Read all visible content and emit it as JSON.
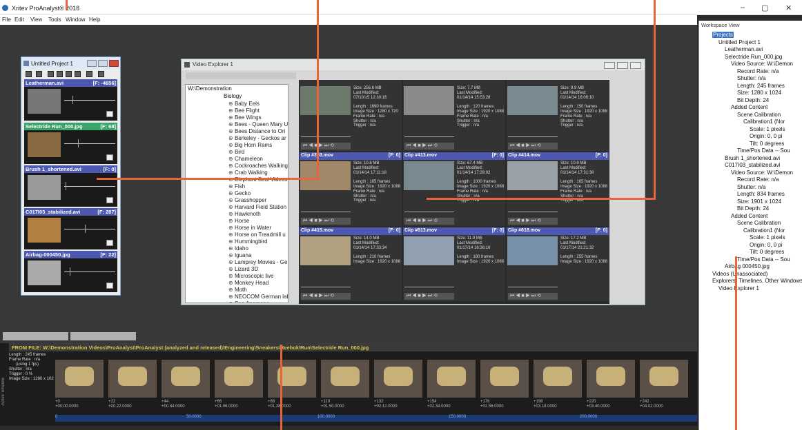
{
  "window": {
    "title": "Xritev ProAnalyst® 2018",
    "min": "–",
    "max": "▢",
    "close": "✕"
  },
  "menu": [
    "File",
    "Edit",
    "View",
    "Tools",
    "Window",
    "Help"
  ],
  "project": {
    "title": "Untitled Project 1",
    "clips": [
      {
        "name": "Leatherman.avi",
        "frame": "[F: -4656]",
        "selected": false
      },
      {
        "name": "Selectride Run_000.jpg",
        "frame": "[F: 68]",
        "selected": true
      },
      {
        "name": "Brush 1_shortened.avi",
        "frame": "[F: 0]",
        "selected": false
      },
      {
        "name": "C017I03_stabilized.avi",
        "frame": "[F: 287]",
        "selected": false
      },
      {
        "name": "Airbag-000450.jpg",
        "frame": "[F: 22]",
        "selected": false
      }
    ]
  },
  "explorer": {
    "title": "Video Explorer 1",
    "path": "W:\\Demonstration",
    "tree_root": "Biology",
    "tree": [
      "Baby Eels",
      "Bee Flight",
      "Bee Wings",
      "Bees - Queen Mary U",
      "Bees Distance to Ori",
      "Berkeley - Geckos ar",
      "Big Horn Rams",
      "Bird",
      "Chameleon",
      "Cockroaches Walking",
      "Crab Walking",
      "Elephant Seal Videos",
      "Fish",
      "Gecko",
      "Grasshopper",
      "Harvard Field Station",
      "Hawkmoth",
      "Horse",
      "Horse in Water",
      "Horse on Treadmill u",
      "Hummingbird",
      "Idaho",
      "Iguana",
      "Lamprey Movies - Ge",
      "Lizard 3D",
      "Microscopic live",
      "Monkey Head",
      "Moth",
      "NEOCOM German lab",
      "Sea Anemone"
    ],
    "cards": [
      {
        "name": "",
        "frame": "",
        "meta": "Size: 256.6 MB\nLast Modified:\n07/10/15 12:30:16\n\nLength : 1690 frames\nImage Size : 1280 x 720\nFrame Rate : n/a\nShutter : n/a\nTrigger : n/a"
      },
      {
        "name": "",
        "frame": "",
        "meta": "Size: 7.7 MB\nLast Modified:\n01/14/14 15:53:28\n\nLength : 120 frames\nImage Size : 1920 x 1088\nFrame Rate : n/a\nShutter : n/a\nTrigger : n/a"
      },
      {
        "name": "",
        "frame": "",
        "meta": "Size: 9.9 MB\nLast Modified:\n01/14/14 16:06:10\n\nLength : 150 frames\nImage Size : 1920 x 1088\nFrame Rate : n/a\nShutter : n/a\nTrigger : n/a"
      },
      {
        "name": "Clip #393.mov",
        "frame": "[F: 0]",
        "meta": "Size: 10.8 MB\nLast Modified:\n01/14/14 17:11:18\n\nLength : 165 frames\nImage Size : 1920 x 1088\nFrame Rate : n/a\nShutter : n/a\nTrigger : n/a"
      },
      {
        "name": "Clip #413.mov",
        "frame": "[F: 0]",
        "meta": "Size: 67.4 MB\nLast Modified:\n01/14/14 17:28:02\n\nLength : 1000 frames\nImage Size : 1920 x 1088\nFrame Rate : n/a\nShutter : n/a\nTrigger : n/a"
      },
      {
        "name": "Clip #414.mov",
        "frame": "[F: 0]",
        "meta": "Size: 10.9 MB\nLast Modified:\n01/14/14 17:31:38\n\nLength : 165 frames\nImage Size : 1920 x 1088\nFrame Rate : n/a\nShutter : n/a\nTrigger : n/a"
      },
      {
        "name": "Clip #415.mov",
        "frame": "[F: 0]",
        "meta": "Size: 14.0 MB\nLast Modified:\n01/14/14 17:33:34\n\nLength : 210 frames\nImage Size : 1920 x 1088"
      },
      {
        "name": "Clip #613.mov",
        "frame": "[F: 0]",
        "meta": "Size: 11.9 MB\nLast Modified:\n01/17/14 16:36:16\n\nLength : 180 frames\nImage Size : 1920 x 1088"
      },
      {
        "name": "Clip #618.mov",
        "frame": "[F: 0]",
        "meta": "Size: 17.2 MB\nLast Modified:\n01/17/14 21:21:32\n\nLength : 255 frames\nImage Size : 1920 x 1088"
      }
    ],
    "controls": "⏮ ◀ ■ ▶ ⏭ ⟲"
  },
  "timeline": {
    "header": "FROM FILE: W:\\Demonstration Videos\\ProAnalyst\\ProAnalyst (analyzed and released)\\Engineering\\Sneakers\\Reebok\\Run\\Selectride Run_000.jpg",
    "info": "Length : 245 frames\nFrame Rate : n/a\n      (using 1 fps)\nShutter : n/a\nTrigger : 0 %\nImage Size : 1280 x 102",
    "frames": [
      "+0\n+00.00.0000",
      "+22\n+00.22.0000",
      "+44\n+00.44.0000",
      "+66\n+01.06.0000",
      "+88\n+01.28.0000",
      "+110\n+01.50.0000",
      "+132\n+02.12.0000",
      "+154\n+02.34.0000",
      "+176\n+02.56.0000",
      "+198\n+03.18.0000",
      "+220\n+03.40.0000",
      "+242\n+04.02.0000"
    ],
    "scale": [
      "0",
      "50.0000",
      "100.0000",
      "150.0000",
      "200.0000"
    ],
    "side_label": "Active Timeline"
  },
  "workspace": {
    "title": "Workspace View",
    "items": [
      {
        "t": "Projects",
        "sel": true,
        "lvl": 1
      },
      {
        "t": "Untitled Project 1",
        "lvl": 2
      },
      {
        "t": "Leatherman.avi",
        "lvl": 3
      },
      {
        "t": "Selectride Run_000.jpg",
        "lvl": 3
      },
      {
        "t": "Video Source: W:\\Demon",
        "lvl": 4
      },
      {
        "t": "Record Rate: n/a",
        "lvl": 5
      },
      {
        "t": "Shutter: n/a",
        "lvl": 5
      },
      {
        "t": "Length: 245 frames",
        "lvl": 5
      },
      {
        "t": "Size: 1280 x 1024",
        "lvl": 5
      },
      {
        "t": "Bit Depth: 24",
        "lvl": 5
      },
      {
        "t": "Added Content",
        "lvl": 4
      },
      {
        "t": "Scene Calibration",
        "lvl": 5
      },
      {
        "t": "Calibration1 (Nor",
        "lvl": 6
      },
      {
        "t": "Scale: 1 pixels",
        "lvl": 7
      },
      {
        "t": "Origin: 0, 0 pi",
        "lvl": 7
      },
      {
        "t": "Tilt: 0 degrees",
        "lvl": 7
      },
      {
        "t": "Time/Pos Data -- Sou",
        "lvl": 5
      },
      {
        "t": "Brush 1_shortened.avi",
        "lvl": 3
      },
      {
        "t": "C017I03_stabilized.avi",
        "lvl": 3
      },
      {
        "t": "Video Source: W:\\Demon",
        "lvl": 4
      },
      {
        "t": "Record Rate: n/a",
        "lvl": 5
      },
      {
        "t": "Shutter: n/a",
        "lvl": 5
      },
      {
        "t": "Length: 834 frames",
        "lvl": 5
      },
      {
        "t": "Size: 1901 x 1024",
        "lvl": 5
      },
      {
        "t": "Bit Depth: 24",
        "lvl": 5
      },
      {
        "t": "Added Content",
        "lvl": 4
      },
      {
        "t": "Scene Calibration",
        "lvl": 5
      },
      {
        "t": "Calibration1 (Nor",
        "lvl": 6
      },
      {
        "t": "Scale: 1 pixels",
        "lvl": 7
      },
      {
        "t": "Origin: 0, 0 pi",
        "lvl": 7
      },
      {
        "t": "Tilt: 0 degrees",
        "lvl": 7
      },
      {
        "t": "Time/Pos Data -- Sou",
        "lvl": 5
      },
      {
        "t": "Airbag 000450.jpg",
        "lvl": 3
      },
      {
        "t": "Videos (Unassociated)",
        "lvl": 1
      },
      {
        "t": "Explorers, Timelines, Other Windows",
        "lvl": 1
      },
      {
        "t": "Video Explorer 1",
        "lvl": 2
      }
    ]
  },
  "colors": {
    "accent": "#e8643a",
    "clip_header": "#4d59b0",
    "selected": "#3aa46a"
  }
}
